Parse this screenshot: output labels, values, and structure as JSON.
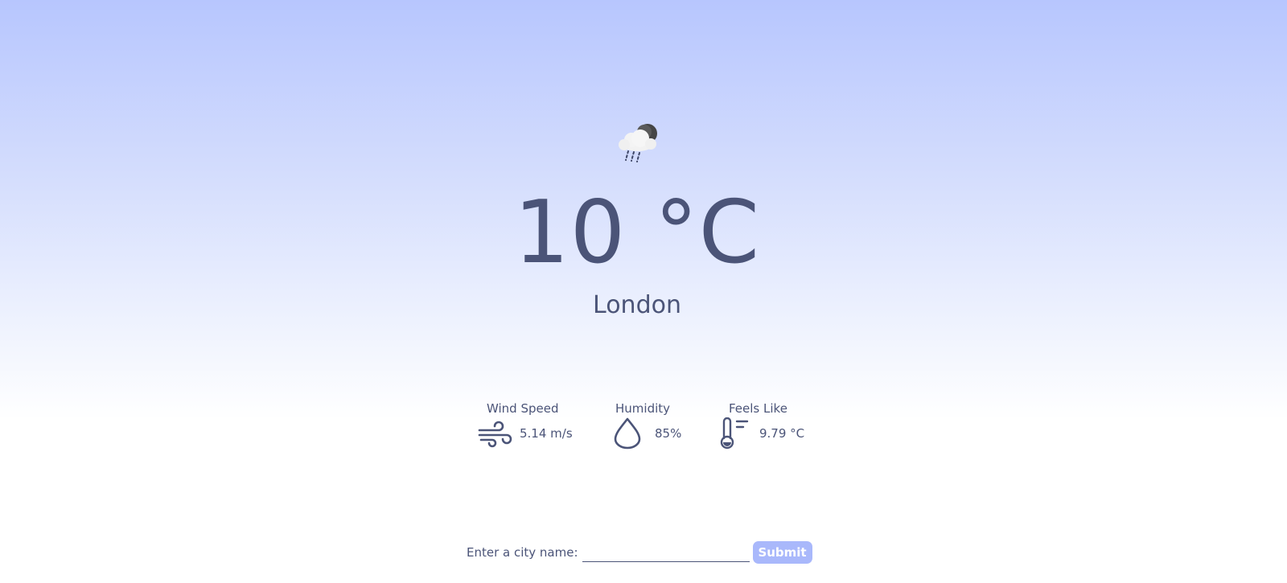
{
  "weather": {
    "condition_icon": "cloud-moon-rain-icon",
    "temperature": "10 °C",
    "city": "London"
  },
  "stats": {
    "wind": {
      "label": "Wind Speed",
      "value": "5.14 m/s",
      "icon": "wind-icon"
    },
    "humidity": {
      "label": "Humidity",
      "value": "85%",
      "icon": "droplet-icon"
    },
    "feels_like": {
      "label": "Feels Like",
      "value": "9.79 °C",
      "icon": "thermometer-icon"
    }
  },
  "form": {
    "label": "Enter a city name:",
    "input_value": "",
    "submit_label": "Submit"
  },
  "colors": {
    "text": "#4b5478",
    "accent": "#a9b8fb",
    "gradient_top": "#b7c6fe",
    "gradient_bottom": "#ffffff"
  }
}
